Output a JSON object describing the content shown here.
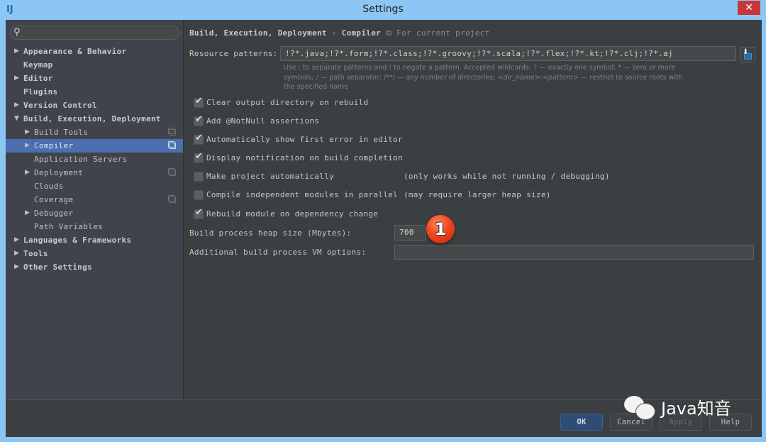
{
  "window": {
    "title": "Settings",
    "logo": "IJ",
    "close_glyph": "✕"
  },
  "sidebar": {
    "search": {
      "placeholder": "",
      "value": ""
    },
    "items": [
      {
        "label": "Appearance & Behavior",
        "level": 0,
        "arrow": "▶",
        "project_icon": false,
        "selected": false
      },
      {
        "label": "Keymap",
        "level": 0,
        "arrow": "",
        "project_icon": false,
        "selected": false
      },
      {
        "label": "Editor",
        "level": 0,
        "arrow": "▶",
        "project_icon": false,
        "selected": false
      },
      {
        "label": "Plugins",
        "level": 0,
        "arrow": "",
        "project_icon": false,
        "selected": false
      },
      {
        "label": "Version Control",
        "level": 0,
        "arrow": "▶",
        "project_icon": false,
        "selected": false
      },
      {
        "label": "Build, Execution, Deployment",
        "level": 0,
        "arrow": "▼",
        "project_icon": false,
        "selected": false
      },
      {
        "label": "Build Tools",
        "level": 1,
        "arrow": "▶",
        "project_icon": true,
        "selected": false
      },
      {
        "label": "Compiler",
        "level": 1,
        "arrow": "▶",
        "project_icon": true,
        "selected": true
      },
      {
        "label": "Application Servers",
        "level": 1,
        "arrow": "",
        "project_icon": false,
        "selected": false
      },
      {
        "label": "Deployment",
        "level": 1,
        "arrow": "▶",
        "project_icon": true,
        "selected": false
      },
      {
        "label": "Clouds",
        "level": 1,
        "arrow": "",
        "project_icon": false,
        "selected": false
      },
      {
        "label": "Coverage",
        "level": 1,
        "arrow": "",
        "project_icon": true,
        "selected": false
      },
      {
        "label": "Debugger",
        "level": 1,
        "arrow": "▶",
        "project_icon": false,
        "selected": false
      },
      {
        "label": "Path Variables",
        "level": 1,
        "arrow": "",
        "project_icon": false,
        "selected": false
      },
      {
        "label": "Languages & Frameworks",
        "level": 0,
        "arrow": "▶",
        "project_icon": false,
        "selected": false
      },
      {
        "label": "Tools",
        "level": 0,
        "arrow": "▶",
        "project_icon": false,
        "selected": false
      },
      {
        "label": "Other Settings",
        "level": 0,
        "arrow": "▶",
        "project_icon": false,
        "selected": false
      }
    ]
  },
  "breadcrumb": {
    "parent": "Build, Execution, Deployment",
    "separator": "›",
    "current": "Compiler",
    "scope": "For current project"
  },
  "resource_patterns": {
    "label": "Resource patterns:",
    "value": "!?*.java;!?*.form;!?*.class;!?*.groovy;!?*.scala;!?*.flex;!?*.kt;!?*.clj;!?*.aj",
    "hint_line1": "Use ; to separate patterns and ! to negate a pattern. Accepted wildcards: ? — exactly one symbol; * — zero or more",
    "hint_line2a": "symbols; / — path separator; /**/ — any number of directories; ",
    "hint_line2b": "<dir_name>:<pattern>",
    "hint_line2c": " — restrict to source roots with",
    "hint_line3": "the specified name"
  },
  "options": [
    {
      "label": "Clear output directory on rebuild",
      "checked": true,
      "note": ""
    },
    {
      "label": "Add @NotNull assertions",
      "checked": true,
      "note": ""
    },
    {
      "label": "Automatically show first error in editor",
      "checked": true,
      "note": ""
    },
    {
      "label": "Display notification on build completion",
      "checked": true,
      "note": ""
    },
    {
      "label": "Make project automatically",
      "checked": false,
      "note": "(only works while not running / debugging)"
    },
    {
      "label": "Compile independent modules in parallel",
      "checked": false,
      "note": "(may require larger heap size)"
    },
    {
      "label": "Rebuild module on dependency change",
      "checked": true,
      "note": ""
    }
  ],
  "heap_size": {
    "label": "Build process heap size (Mbytes):",
    "value": "700"
  },
  "vm_options": {
    "label": "Additional build process VM options:",
    "value": ""
  },
  "annotation_badge": "1",
  "buttons": {
    "ok": "OK",
    "cancel": "Cancel",
    "apply": "Apply",
    "help": "Help"
  },
  "watermark": "Java知音",
  "colors": {
    "selection": "#4b6eaf",
    "panel": "#3c3f41",
    "sidebar": "#41434c",
    "close": "#c7373a",
    "badge": "#f2451b"
  }
}
